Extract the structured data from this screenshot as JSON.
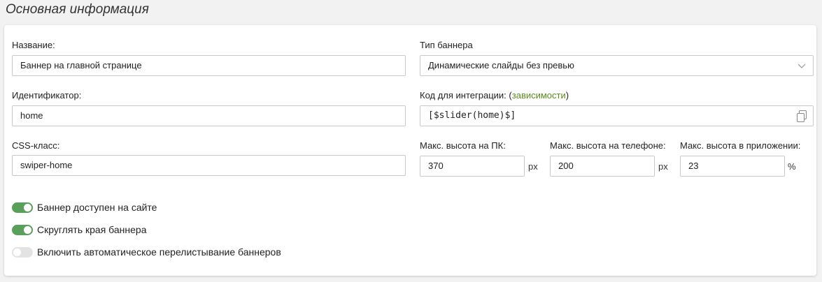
{
  "section": {
    "title": "Основная информация"
  },
  "fields": {
    "name": {
      "label": "Название:",
      "value": "Баннер на главной странице"
    },
    "banner_type": {
      "label": "Тип баннера",
      "value": "Динамические слайды без превью"
    },
    "identifier": {
      "label": "Идентификатор:",
      "value": "home"
    },
    "integration": {
      "label_prefix": "Код для интеграции: (",
      "link": "зависимости",
      "label_suffix": ")",
      "value": "[$slider(home)$]"
    },
    "css_class": {
      "label": "CSS-класс:",
      "value": "swiper-home"
    },
    "max_height_pc": {
      "label": "Макс. высота на ПК:",
      "value": "370",
      "unit": "px"
    },
    "max_height_phone": {
      "label": "Макс. высота на телефоне:",
      "value": "200",
      "unit": "px"
    },
    "max_height_app": {
      "label": "Макс. высота в приложении:",
      "value": "23",
      "unit": "%"
    }
  },
  "toggles": [
    {
      "label": "Баннер доступен на сайте",
      "on": true
    },
    {
      "label": "Скруглять края баннера",
      "on": true
    },
    {
      "label": "Включить автоматическое перелистывание баннеров",
      "on": false
    }
  ],
  "colors": {
    "toggle_on": "#5aa05a",
    "toggle_off": "#e3e3e3",
    "link": "#5b8a1d"
  },
  "icons": {
    "select": "chevron-down-icon",
    "copy": "copy-icon"
  }
}
